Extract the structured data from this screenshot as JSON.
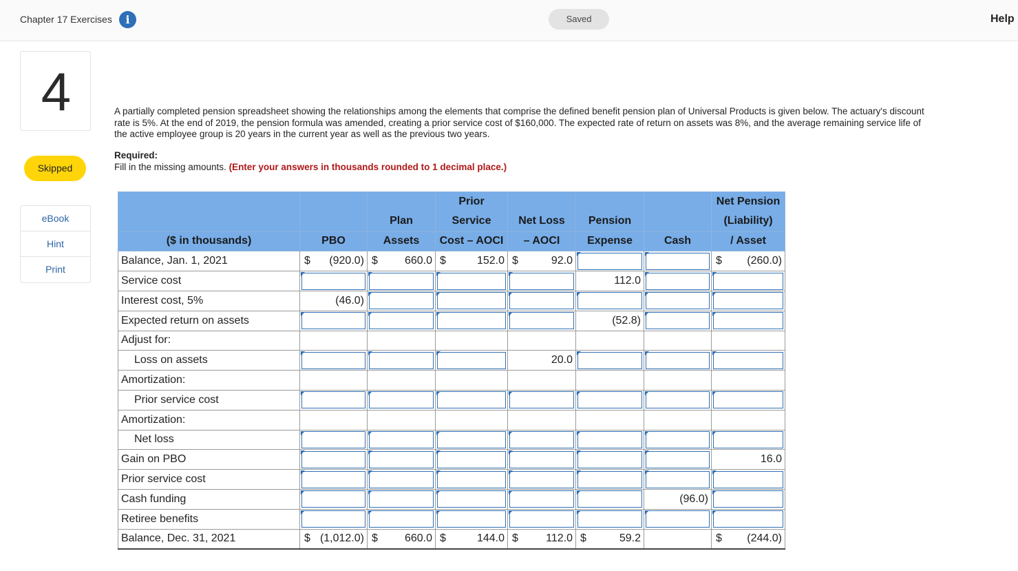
{
  "header": {
    "chapter_title": "Chapter 17 Exercises",
    "info_icon": "i",
    "saved": "Saved",
    "help": "Help"
  },
  "sidebar": {
    "question_number": "4",
    "status": "Skipped",
    "tools": [
      "eBook",
      "Hint",
      "Print"
    ]
  },
  "question": {
    "text": "A partially completed pension spreadsheet showing the relationships among the elements that comprise the defined benefit pension plan of Universal Products is given below. The actuary's discount rate is 5%. At the end of 2019, the pension formula was amended, creating a prior service cost of $160,000. The expected rate of return on assets was 8%, and the average remaining service life of the active employee group is 20 years in the current year as well as the previous two years.",
    "required_label": "Required:",
    "required_text": "Fill in the missing amounts. ",
    "required_note": "(Enter your answers in thousands rounded to 1 decimal place.)"
  },
  "table": {
    "header_rows": [
      [
        "",
        "",
        "",
        "Prior",
        "",
        "",
        "",
        "Net Pension"
      ],
      [
        "",
        "",
        "Plan",
        "Service",
        "Net Loss",
        "Pension",
        "",
        "(Liability)"
      ],
      [
        "($ in thousands)",
        "PBO",
        "Assets",
        "Cost – AOCI",
        "– AOCI",
        "Expense",
        "Cash",
        "/ Asset"
      ]
    ],
    "rows": [
      {
        "label": "Balance, Jan. 1, 2021",
        "indent": false,
        "cells": [
          {
            "t": "money",
            "sym": "$",
            "v": "(920.0)"
          },
          {
            "t": "money",
            "sym": "$",
            "v": "660.0"
          },
          {
            "t": "money",
            "sym": "$",
            "v": "152.0"
          },
          {
            "t": "money",
            "sym": "$",
            "v": "92.0"
          },
          {
            "t": "input"
          },
          {
            "t": "input"
          },
          {
            "t": "money",
            "sym": "$",
            "v": "(260.0)"
          }
        ]
      },
      {
        "label": "Service cost",
        "indent": false,
        "cells": [
          {
            "t": "input"
          },
          {
            "t": "input"
          },
          {
            "t": "input"
          },
          {
            "t": "input"
          },
          {
            "t": "num",
            "v": "112.0"
          },
          {
            "t": "input"
          },
          {
            "t": "input"
          }
        ]
      },
      {
        "label": "Interest cost, 5%",
        "indent": false,
        "cells": [
          {
            "t": "num",
            "v": "(46.0)"
          },
          {
            "t": "input"
          },
          {
            "t": "input"
          },
          {
            "t": "input"
          },
          {
            "t": "input"
          },
          {
            "t": "input"
          },
          {
            "t": "input"
          }
        ]
      },
      {
        "label": "Expected return on assets",
        "indent": false,
        "cells": [
          {
            "t": "input"
          },
          {
            "t": "input"
          },
          {
            "t": "input"
          },
          {
            "t": "input"
          },
          {
            "t": "num",
            "v": "(52.8)"
          },
          {
            "t": "input"
          },
          {
            "t": "input"
          }
        ]
      },
      {
        "label": "Adjust for:",
        "indent": false,
        "cells": [
          {
            "t": "empty"
          },
          {
            "t": "empty"
          },
          {
            "t": "empty"
          },
          {
            "t": "empty"
          },
          {
            "t": "empty"
          },
          {
            "t": "empty"
          },
          {
            "t": "empty"
          }
        ]
      },
      {
        "label": "Loss on assets",
        "indent": true,
        "cells": [
          {
            "t": "input"
          },
          {
            "t": "input"
          },
          {
            "t": "input"
          },
          {
            "t": "num",
            "v": "20.0"
          },
          {
            "t": "input"
          },
          {
            "t": "input"
          },
          {
            "t": "input"
          }
        ]
      },
      {
        "label": "Amortization:",
        "indent": false,
        "cells": [
          {
            "t": "empty"
          },
          {
            "t": "empty"
          },
          {
            "t": "empty"
          },
          {
            "t": "empty"
          },
          {
            "t": "empty"
          },
          {
            "t": "empty"
          },
          {
            "t": "empty"
          }
        ]
      },
      {
        "label": "Prior service cost",
        "indent": true,
        "cells": [
          {
            "t": "input"
          },
          {
            "t": "input"
          },
          {
            "t": "input"
          },
          {
            "t": "input"
          },
          {
            "t": "input"
          },
          {
            "t": "input"
          },
          {
            "t": "input"
          }
        ]
      },
      {
        "label": "Amortization:",
        "indent": false,
        "cells": [
          {
            "t": "empty"
          },
          {
            "t": "empty"
          },
          {
            "t": "empty"
          },
          {
            "t": "empty"
          },
          {
            "t": "empty"
          },
          {
            "t": "empty"
          },
          {
            "t": "empty"
          }
        ]
      },
      {
        "label": "Net loss",
        "indent": true,
        "cells": [
          {
            "t": "input"
          },
          {
            "t": "input"
          },
          {
            "t": "input"
          },
          {
            "t": "input"
          },
          {
            "t": "input"
          },
          {
            "t": "input"
          },
          {
            "t": "input"
          }
        ]
      },
      {
        "label": "Gain on PBO",
        "indent": false,
        "cells": [
          {
            "t": "input"
          },
          {
            "t": "input"
          },
          {
            "t": "input"
          },
          {
            "t": "input"
          },
          {
            "t": "input"
          },
          {
            "t": "input"
          },
          {
            "t": "num",
            "v": "16.0"
          }
        ]
      },
      {
        "label": "Prior service cost",
        "indent": false,
        "cells": [
          {
            "t": "input"
          },
          {
            "t": "input"
          },
          {
            "t": "input"
          },
          {
            "t": "input"
          },
          {
            "t": "input"
          },
          {
            "t": "input"
          },
          {
            "t": "input"
          }
        ]
      },
      {
        "label": "Cash funding",
        "indent": false,
        "cells": [
          {
            "t": "input"
          },
          {
            "t": "input"
          },
          {
            "t": "input"
          },
          {
            "t": "input"
          },
          {
            "t": "input"
          },
          {
            "t": "num",
            "v": "(96.0)"
          },
          {
            "t": "input"
          }
        ]
      },
      {
        "label": "Retiree benefits",
        "indent": false,
        "cells": [
          {
            "t": "input"
          },
          {
            "t": "input"
          },
          {
            "t": "input"
          },
          {
            "t": "input"
          },
          {
            "t": "input"
          },
          {
            "t": "input"
          },
          {
            "t": "input"
          }
        ]
      },
      {
        "label": "Balance, Dec. 31, 2021",
        "indent": false,
        "cells": [
          {
            "t": "money",
            "sym": "$",
            "v": "(1,012.0)"
          },
          {
            "t": "money",
            "sym": "$",
            "v": "660.0"
          },
          {
            "t": "money",
            "sym": "$",
            "v": "144.0"
          },
          {
            "t": "money",
            "sym": "$",
            "v": "112.0"
          },
          {
            "t": "money",
            "sym": "$",
            "v": "59.2"
          },
          {
            "t": "empty"
          },
          {
            "t": "money",
            "sym": "$",
            "v": "(244.0)"
          }
        ]
      }
    ]
  },
  "colors": {
    "header_blue": "#78ade8",
    "input_border": "#2f6fb4",
    "skipped_yellow": "#ffd50a",
    "note_red": "#b01818"
  }
}
